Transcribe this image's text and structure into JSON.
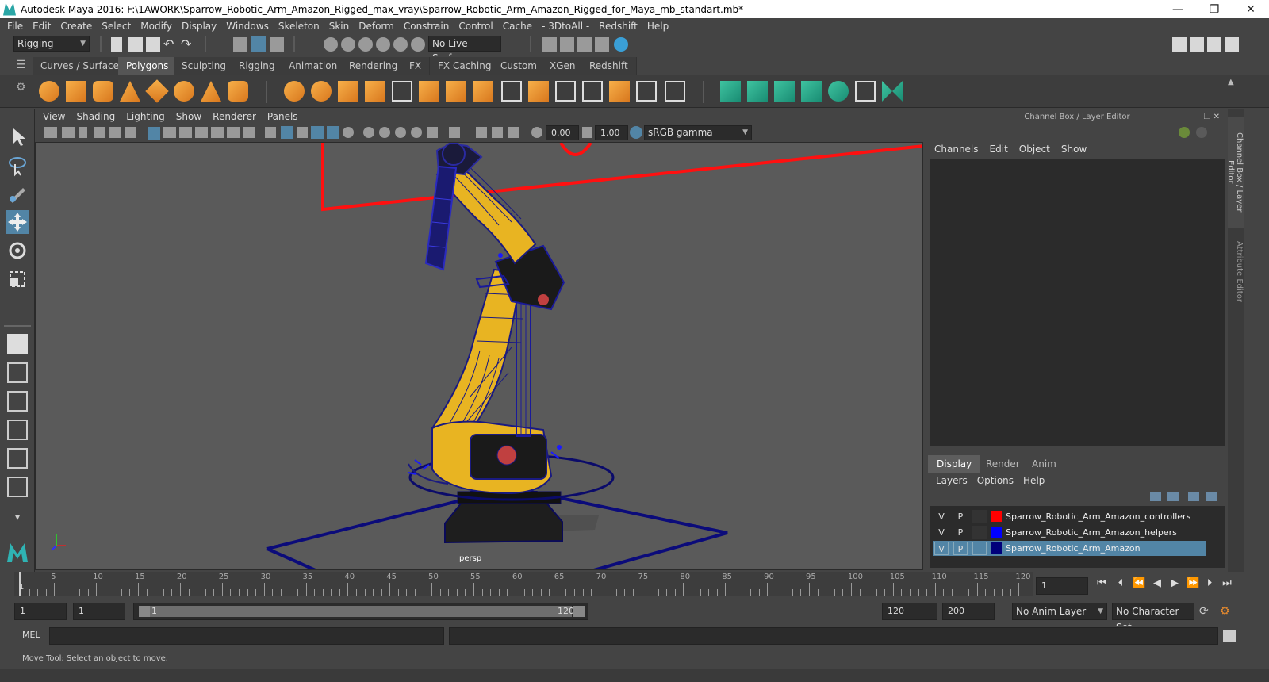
{
  "window": {
    "title": "Autodesk Maya 2016: F:\\1AWORK\\Sparrow_Robotic_Arm_Amazon_Rigged_max_vray\\Sparrow_Robotic_Arm_Amazon_Rigged_for_Maya_mb_standart.mb*",
    "minimize": "—",
    "restore": "❐",
    "close": "✕"
  },
  "menu": [
    "File",
    "Edit",
    "Create",
    "Select",
    "Modify",
    "Display",
    "Windows",
    "Skeleton",
    "Skin",
    "Deform",
    "Constrain",
    "Control",
    "Cache",
    "- 3DtoAll -",
    "Redshift",
    "Help"
  ],
  "status": {
    "menuset": "Rigging",
    "live_surface": "No Live Surface"
  },
  "shelf_tabs": [
    "Curves / Surfaces",
    "Polygons",
    "Sculpting",
    "Rigging",
    "Animation",
    "Rendering",
    "FX",
    "FX Caching",
    "Custom",
    "XGen",
    "Redshift"
  ],
  "shelf_active": "Polygons",
  "viewport": {
    "menu": [
      "View",
      "Shading",
      "Lighting",
      "Show",
      "Renderer",
      "Panels"
    ],
    "exposure": "0.00",
    "gamma": "1.00",
    "color_space": "sRGB gamma",
    "camera_label": "persp"
  },
  "channel_box": {
    "header": "Channel Box / Layer Editor",
    "menu": [
      "Channels",
      "Edit",
      "Object",
      "Show"
    ]
  },
  "layer_editor": {
    "tabs": [
      "Display",
      "Render",
      "Anim"
    ],
    "active_tab": "Display",
    "menu": [
      "Layers",
      "Options",
      "Help"
    ],
    "layers": [
      {
        "v": "V",
        "p": "P",
        "color": "#ff0000",
        "name": "Sparrow_Robotic_Arm_Amazon_controllers",
        "selected": false
      },
      {
        "v": "V",
        "p": "P",
        "color": "#0000ff",
        "name": "Sparrow_Robotic_Arm_Amazon_helpers",
        "selected": false
      },
      {
        "v": "V",
        "p": "P",
        "color": "#00007a",
        "name": "Sparrow_Robotic_Arm_Amazon",
        "selected": true
      }
    ]
  },
  "side_tabs": [
    "Channel Box / Layer Editor",
    "Attribute Editor"
  ],
  "time_slider": {
    "tick_labels": [
      "5",
      "10",
      "15",
      "20",
      "25",
      "30",
      "35",
      "40",
      "45",
      "50",
      "55",
      "60",
      "65",
      "70",
      "75",
      "80",
      "85",
      "90",
      "95",
      "100",
      "105",
      "110",
      "115",
      "120"
    ],
    "start_marker": "1",
    "current_frame": "1"
  },
  "range": {
    "start": "1",
    "playback_start": "1",
    "range_start_label": "1",
    "range_end_label": "120",
    "playback_end": "120",
    "end": "200",
    "anim_layer": "No Anim Layer",
    "character_set": "No Character Set"
  },
  "mel": {
    "label": "MEL"
  },
  "help_line": "Move Tool: Select an object to move.",
  "colors": {
    "accent": "#5285a6",
    "robot_yellow": "#e8b422",
    "wire_blue": "#1a1a80",
    "controller_red": "#ff0000"
  }
}
